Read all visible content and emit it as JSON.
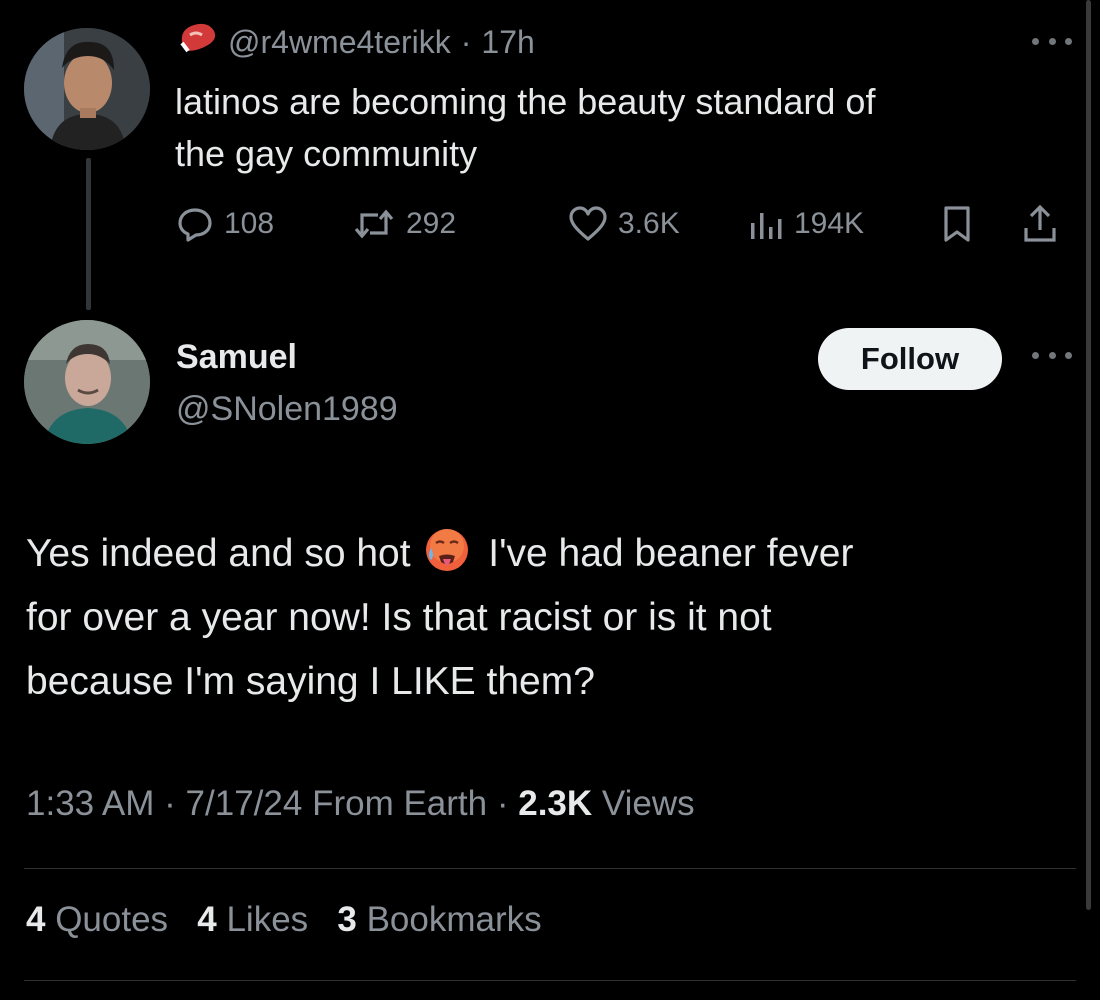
{
  "parent": {
    "handle": "@r4wme4terikk",
    "separator": "·",
    "time": "17h",
    "badge_icon": "steak-icon",
    "text_line1": "latinos are becoming the beauty standard of",
    "text_line2": "the gay community",
    "replies": "108",
    "reposts": "292",
    "likes": "3.6K",
    "views": "194K"
  },
  "reply": {
    "name": "Samuel",
    "handle": "@SNolen1989",
    "follow_label": "Follow",
    "text_part1": "Yes indeed and so hot",
    "emoji_icon": "hot-face-emoji-icon",
    "text_part2": "I've had beaner fever",
    "text_line2": "for over a year now! Is that racist or is it not",
    "text_line3": "because I'm saying I LIKE them?",
    "time": "1:33 AM",
    "sep1": "·",
    "date": "7/17/24",
    "location": "From Earth",
    "sep2": "·",
    "views_count": "2.3K",
    "views_label": "Views",
    "quotes_count": "4",
    "quotes_label": "Quotes",
    "likes_count": "4",
    "likes_label": "Likes",
    "bookmarks_count": "3",
    "bookmarks_label": "Bookmarks"
  },
  "colors": {
    "background": "#000000",
    "text": "#e7e9ea",
    "secondary": "#8b9199",
    "follow_bg": "#eff3f4"
  }
}
